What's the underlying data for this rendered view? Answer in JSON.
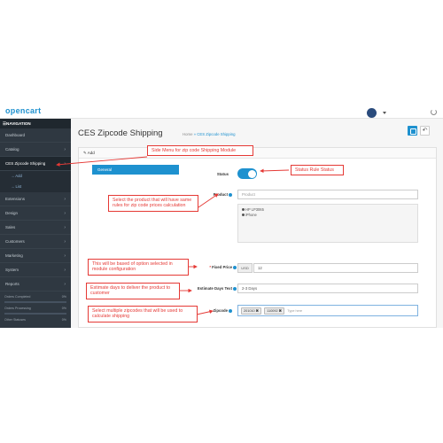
{
  "header": {
    "logo_text": "opencart"
  },
  "sidebar": {
    "heading": "NAVIGATION",
    "items": [
      {
        "label": "Dashboard",
        "chevron": false,
        "active": false
      },
      {
        "label": "Catalog",
        "chevron": true,
        "active": false
      },
      {
        "label": "CES Zipcode Shipping",
        "chevron": true,
        "active": true
      },
      {
        "label": "Add",
        "sub": true
      },
      {
        "label": "List",
        "sub": true
      },
      {
        "label": "Extensions",
        "chevron": true,
        "active": false
      },
      {
        "label": "Design",
        "chevron": true,
        "active": false
      },
      {
        "label": "Sales",
        "chevron": true,
        "active": false
      },
      {
        "label": "Customers",
        "chevron": true,
        "active": false
      },
      {
        "label": "Marketing",
        "chevron": true,
        "active": false
      },
      {
        "label": "System",
        "chevron": true,
        "active": false
      },
      {
        "label": "Reports",
        "chevron": true,
        "active": false
      }
    ],
    "stats": [
      {
        "label": "Orders Completed",
        "pct": "0%"
      },
      {
        "label": "Orders Processing",
        "pct": "0%"
      },
      {
        "label": "Other Statuses",
        "pct": "0%"
      }
    ]
  },
  "page": {
    "title": "CES Zipcode Shipping",
    "breadcrumb_home": "Home",
    "breadcrumb_sep": "»",
    "breadcrumb_current": "CES Zipcode Shipping",
    "back_icon": "↶",
    "panel_heading": "✎ Add",
    "tab_general": "General"
  },
  "form": {
    "status_label": "Status",
    "status_on": true,
    "product_label": "Product",
    "product_placeholder": "Product",
    "products": [
      "HP LP3065",
      "iPhone"
    ],
    "fixed_price_label": "Fixed Price",
    "fixed_price_required": "*",
    "currency_addon": "USD",
    "fixed_price_value": "12",
    "estimate_label": "Estimate Days Text",
    "estimate_value": "2-3 Days",
    "zipcode_label": "Zipcode",
    "zipcodes": [
      "201010",
      "110092"
    ],
    "zipcode_remove": "✖",
    "zipcode_placeholder": "Type here"
  },
  "annotations": {
    "side_menu": "Side Menu for zip code Shipping Module",
    "status_rule": "Status Rule Status",
    "product": "Select the product that will have same rules for zip code prices calculation",
    "fixed_price": "This will be based of option selected in module configuration",
    "estimate_days": "Estimate days to deliver the product to customer",
    "zipcodes": "Select multiple zipcodes that will be used to calculate shipping"
  },
  "colors": {
    "accent": "#1e91cf",
    "sidebar_bg": "#2f3841",
    "annotation": "#e53935"
  }
}
